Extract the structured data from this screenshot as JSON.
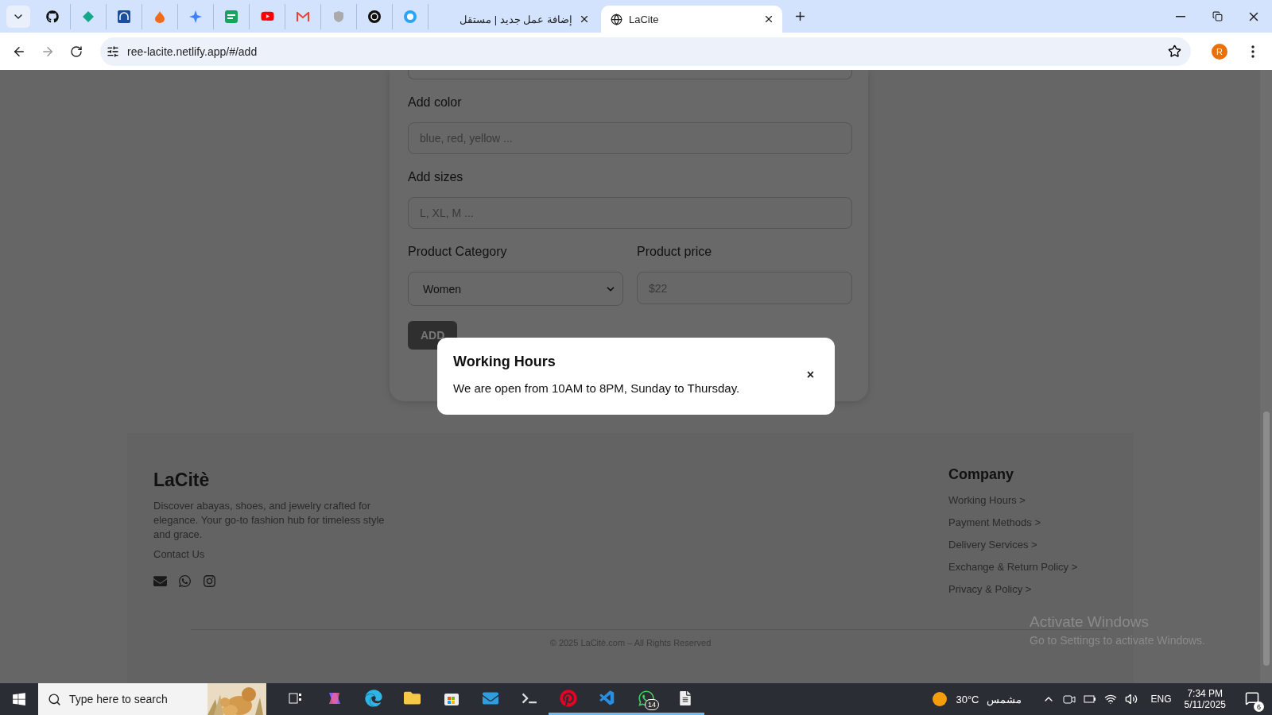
{
  "browser": {
    "tabs": [
      {
        "title": "إضافة عمل جديد | مستقل",
        "selected": false
      },
      {
        "title": "LaCite",
        "selected": true
      }
    ],
    "url": "ree-lacite.netlify.app/#/add",
    "profile_initial": "R"
  },
  "form": {
    "fields": [
      {
        "label": "Add color",
        "placeholder": "blue, red, yellow ..."
      },
      {
        "label": "Add sizes",
        "placeholder": "L, XL, M ..."
      }
    ],
    "category": {
      "label": "Product Category",
      "value": "Women"
    },
    "price": {
      "label": "Product price",
      "placeholder": "$22"
    },
    "submit": "ADD"
  },
  "modal": {
    "title": "Working Hours",
    "message": "We are open from 10AM to 8PM, Sunday to Thursday.",
    "close": "×"
  },
  "footer": {
    "brand": "LaCitè",
    "description": "Discover abayas, shoes, and jewelry crafted for elegance. Your go-to fashion hub for timeless style and grace.",
    "contact": "Contact Us",
    "company": {
      "heading": "Company",
      "links": [
        "Working Hours >",
        "Payment Methods >",
        "Delivery Services >",
        "Exchange & Return Policy >",
        "Privacy & Policy >"
      ]
    },
    "copyright": "© 2025 LaCitè.com – All Rights Reserved"
  },
  "windows_notice": {
    "title": "Activate Windows",
    "subtitle": "Go to Settings to activate Windows."
  },
  "taskbar": {
    "search_placeholder": "Type here to search",
    "apps": [
      {
        "kind": "taskview",
        "running": false
      },
      {
        "kind": "copilot",
        "running": false
      },
      {
        "kind": "edge",
        "running": false
      },
      {
        "kind": "explorer",
        "running": false
      },
      {
        "kind": "store",
        "running": false
      },
      {
        "kind": "mail",
        "running": false
      },
      {
        "kind": "terminal",
        "running": false
      },
      {
        "kind": "pinterest",
        "running": true
      },
      {
        "kind": "vscode",
        "running": true
      },
      {
        "kind": "whatsapp",
        "running": true,
        "badge": "14"
      },
      {
        "kind": "notepad",
        "running": true
      }
    ],
    "weather": {
      "temperature": "30°C",
      "condition": "مشمس"
    },
    "language": "ENG",
    "time": "7:34 PM",
    "date": "5/11/2025",
    "notifications": "6"
  }
}
